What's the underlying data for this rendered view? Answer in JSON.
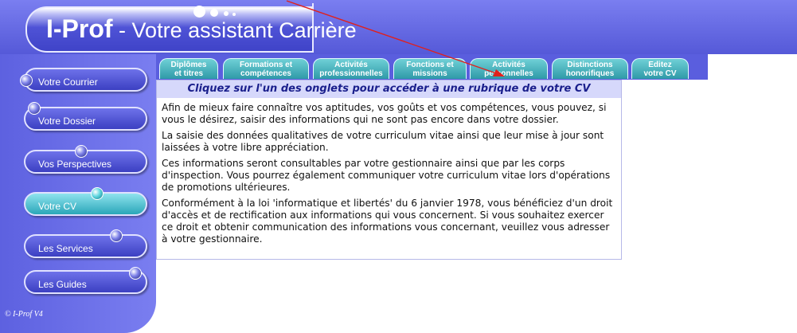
{
  "header": {
    "brand": "I-Prof",
    "subtitle": " - Votre assistant Carrière"
  },
  "sidebar": {
    "items": [
      {
        "label": "Votre Courrier"
      },
      {
        "label": "Votre Dossier"
      },
      {
        "label": "Vos Perspectives"
      },
      {
        "label": "Votre CV"
      },
      {
        "label": "Les Services"
      },
      {
        "label": "Les Guides"
      }
    ],
    "active": "Votre CV",
    "copyright": "© I-Prof V4"
  },
  "tabs": [
    {
      "line1": "Diplômes",
      "line2": "et titres"
    },
    {
      "line1": "Formations et",
      "line2": "compétences"
    },
    {
      "line1": "Activités",
      "line2": "professionnelles"
    },
    {
      "line1": "Fonctions et",
      "line2": "missions"
    },
    {
      "line1": "Activités",
      "line2": "personnelles"
    },
    {
      "line1": "Distinctions",
      "line2": "honorifiques"
    },
    {
      "line1": "Editez",
      "line2": "votre CV"
    }
  ],
  "content": {
    "title": "Cliquez sur l'un des onglets pour accéder à une rubrique de votre CV",
    "paragraphs": [
      "Afin de mieux faire connaître vos aptitudes, vos goûts et vos compétences, vous pouvez, si vous le désirez, saisir des informations qui ne sont pas encore dans votre dossier.",
      "La saisie des données qualitatives de votre curriculum vitae ainsi que leur mise à jour sont laissées à votre libre appréciation.",
      "Ces informations seront consultables par votre gestionnaire ainsi que par les corps d'inspection. Vous pourrez également communiquer votre curriculum vitae lors d'opérations de promotions ultérieures.",
      "Conformément à la loi 'informatique et libertés' du 6 janvier 1978, vous bénéficiez d'un droit d'accès et de rectification aux informations qui vous concernent. Si vous souhaitez exercer ce droit et obtenir communication des informations vous concernant, veuillez vous adresser à votre gestionnaire."
    ]
  },
  "colors": {
    "header_blue": "#5559d8",
    "tab_teal": "#2f9aa8",
    "title_band": "#d6d8fb",
    "arrow_red": "#e0201c"
  }
}
